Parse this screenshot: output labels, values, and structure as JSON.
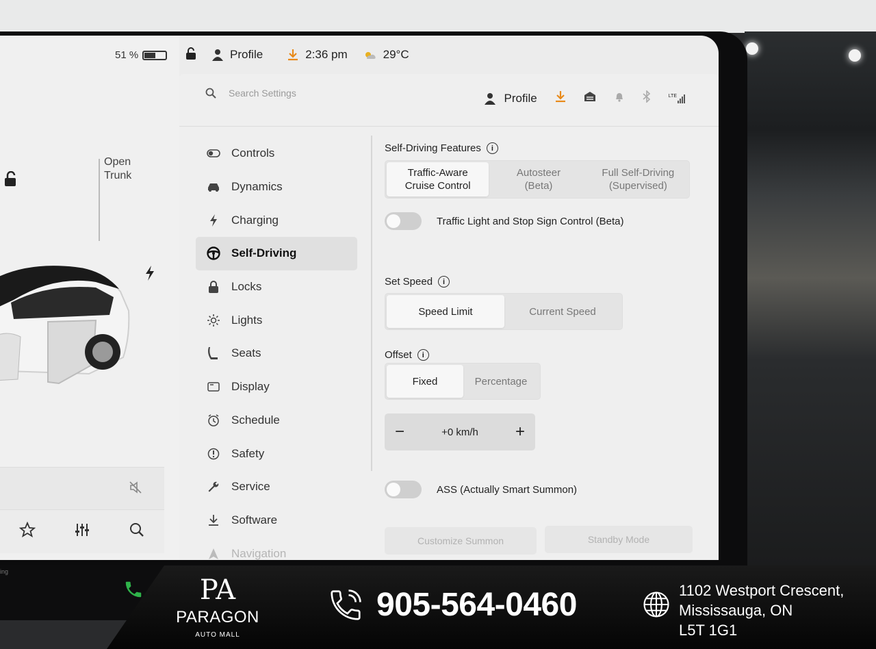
{
  "car_panel": {
    "battery_percent": "51 %",
    "battery_level": 0.51,
    "open_trunk_line1": "Open",
    "open_trunk_line2": "Trunk"
  },
  "statusbar": {
    "profile_label": "Profile",
    "time": "2:36 pm",
    "temperature": "29°C"
  },
  "settings": {
    "search_placeholder": "Search Settings",
    "profile_label": "Profile",
    "signal_label": "LTE",
    "nav": [
      {
        "label": "Controls",
        "icon": "toggle-icon"
      },
      {
        "label": "Dynamics",
        "icon": "car-icon"
      },
      {
        "label": "Charging",
        "icon": "bolt-icon"
      },
      {
        "label": "Self-Driving",
        "icon": "steering-wheel-icon"
      },
      {
        "label": "Locks",
        "icon": "lock-icon"
      },
      {
        "label": "Lights",
        "icon": "sun-icon"
      },
      {
        "label": "Seats",
        "icon": "seat-icon"
      },
      {
        "label": "Display",
        "icon": "display-icon"
      },
      {
        "label": "Schedule",
        "icon": "clock-icon"
      },
      {
        "label": "Safety",
        "icon": "alert-icon"
      },
      {
        "label": "Service",
        "icon": "wrench-icon"
      },
      {
        "label": "Software",
        "icon": "download-icon"
      },
      {
        "label": "Navigation",
        "icon": "navigation-icon"
      }
    ],
    "active_nav": "Self-Driving",
    "features": {
      "title": "Self-Driving Features",
      "options": [
        {
          "line1": "Traffic-Aware",
          "line2": "Cruise Control",
          "selected": true
        },
        {
          "line1": "Autosteer",
          "line2": "(Beta)",
          "selected": false
        },
        {
          "line1": "Full Self-Driving",
          "line2": "(Supervised)",
          "selected": false
        }
      ]
    },
    "traffic_light_label": "Traffic Light and Stop Sign Control (Beta)",
    "set_speed": {
      "title": "Set Speed",
      "options": [
        "Speed Limit",
        "Current Speed"
      ],
      "selected": "Speed Limit"
    },
    "offset": {
      "title": "Offset",
      "options": [
        "Fixed",
        "Percentage"
      ],
      "selected": "Fixed",
      "value": "+0 km/h",
      "minus": "−",
      "plus": "+"
    },
    "ass_label": "ASS (Actually Smart Summon)",
    "customize_summon": "Customize Summon",
    "standby_mode": "Standby Mode"
  },
  "dock": {
    "small_text": "ing"
  },
  "dealer": {
    "logo_mark": "PA",
    "name": "PARAGON",
    "sub": "AUTO MALL",
    "phone": "905-564-0460",
    "address_line1": "1102 Westport Crescent,",
    "address_line2": "Mississauga, ON",
    "address_line3": "L5T 1G1"
  },
  "colors": {
    "accent_orange": "#e88a1a",
    "phone_green": "#2fb34a"
  }
}
